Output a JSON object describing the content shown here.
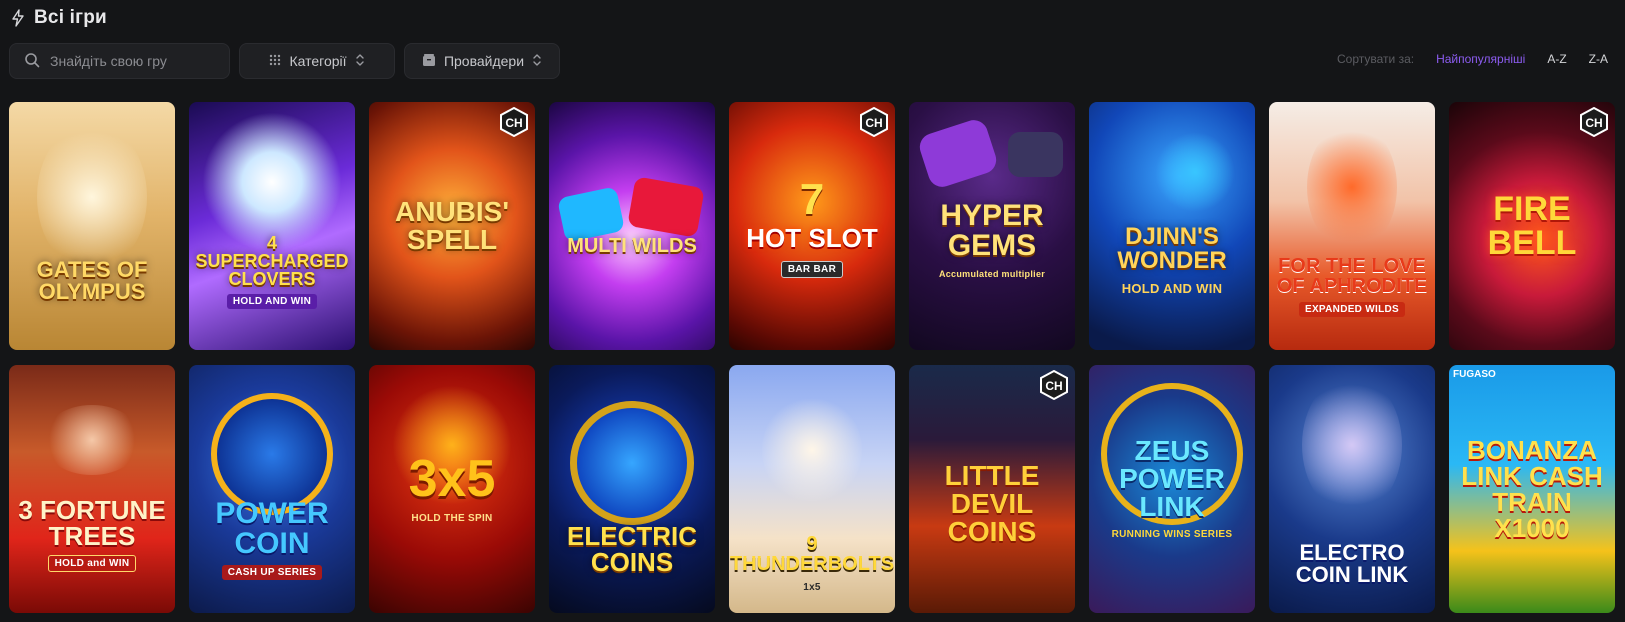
{
  "header": {
    "title": "Всі ігри",
    "icon": "lightning-icon"
  },
  "filters": {
    "search_placeholder": "Знайдіть свою гру",
    "categories_label": "Категорії",
    "providers_label": "Провайдери"
  },
  "sort": {
    "caption": "Сортувати за:",
    "options": [
      "Найпопулярніші",
      "A-Z",
      "Z-A"
    ],
    "active": "Найпопулярніші",
    "active_color": "#8c5cf0"
  },
  "games": [
    {
      "title": "Gates of Olympus",
      "sub": "",
      "badge": false
    },
    {
      "title": "4 Supercharged Clovers",
      "sub": "HOLD AND WIN",
      "badge": false
    },
    {
      "title": "Anubis' Spell",
      "sub": "",
      "badge": true
    },
    {
      "title": "Multi Wilds",
      "sub": "",
      "badge": false
    },
    {
      "title": "Hot Slot",
      "sub": "BAR BAR",
      "badge": true
    },
    {
      "title": "Hyper Gems",
      "sub": "Accumulated multiplier",
      "badge": false
    },
    {
      "title": "Djinn's Wonder",
      "sub": "HOLD AND WIN",
      "badge": false
    },
    {
      "title": "For the Love of Aphrodite",
      "sub": "EXPANDED WILDS",
      "badge": false
    },
    {
      "title": "Fire Bell",
      "sub": "",
      "badge": true
    },
    {
      "title": "3 Fortune Trees",
      "sub": "HOLD and WIN",
      "badge": false
    },
    {
      "title": "Power Coin",
      "sub": "CASH UP SERIES",
      "badge": false
    },
    {
      "title": "3x5",
      "sub": "HOLD THE SPIN",
      "badge": false
    },
    {
      "title": "Electric Coins",
      "sub": "",
      "badge": false
    },
    {
      "title": "9 Thunderbolts",
      "sub": "1x5",
      "badge": false
    },
    {
      "title": "Little Devil Coins",
      "sub": "",
      "badge": true
    },
    {
      "title": "Zeus Power Link",
      "sub": "RUNNING WINS SERIES",
      "badge": false
    },
    {
      "title": "Electro Coin Link",
      "sub": "",
      "badge": false
    },
    {
      "title": "Bonanza Link Cash Train X1000",
      "sub": "",
      "badge": false,
      "provider": "FUGASO"
    }
  ]
}
